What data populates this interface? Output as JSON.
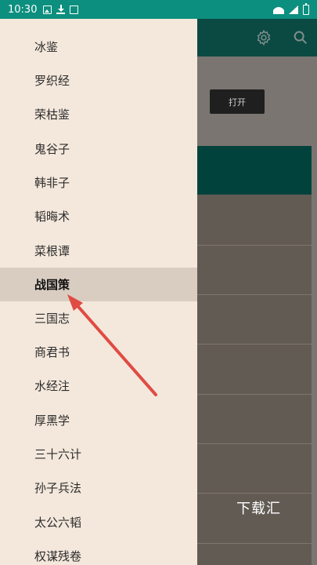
{
  "status_bar": {
    "time": "10:30"
  },
  "toolbar": {
    "settings_icon": "gear-icon",
    "search_icon": "search-icon"
  },
  "content": {
    "open_button_label": "打开",
    "download_label": "下载汇"
  },
  "drawer": {
    "items": [
      {
        "label": "冰鉴"
      },
      {
        "label": "罗织经"
      },
      {
        "label": "荣枯鉴"
      },
      {
        "label": "鬼谷子"
      },
      {
        "label": "韩非子"
      },
      {
        "label": "韬晦术"
      },
      {
        "label": "菜根谭"
      },
      {
        "label": "战国策",
        "selected": true
      },
      {
        "label": "三国志"
      },
      {
        "label": "商君书"
      },
      {
        "label": "水经注"
      },
      {
        "label": "厚黑学"
      },
      {
        "label": "三十六计"
      },
      {
        "label": "孙子兵法"
      },
      {
        "label": "太公六韬"
      },
      {
        "label": "权谋残卷"
      }
    ]
  },
  "colors": {
    "status_bar": "#0d8f7f",
    "drawer_background": "#f4e8dc",
    "selected_item": "#d9cdc2",
    "arrow": "#e04b43"
  }
}
